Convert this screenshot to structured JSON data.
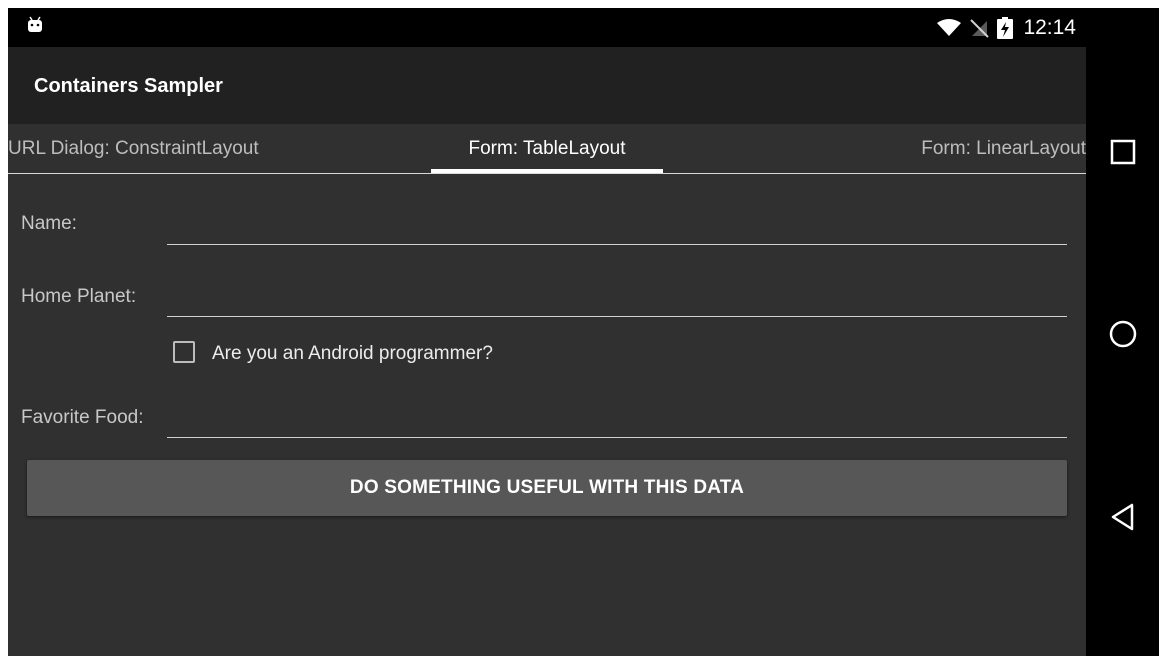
{
  "status_bar": {
    "time": "12:14",
    "icons": [
      "android-icon",
      "wifi-icon",
      "no-sim-icon",
      "battery-charging-icon"
    ]
  },
  "app_bar": {
    "title": "Containers Sampler"
  },
  "tabs": [
    {
      "label": "URL Dialog: ConstraintLayout",
      "selected": false
    },
    {
      "label": "Form: TableLayout",
      "selected": true
    },
    {
      "label": "Form: LinearLayout",
      "selected": false
    }
  ],
  "form": {
    "name_label": "Name:",
    "name_value": "",
    "home_planet_label": "Home Planet:",
    "home_planet_value": "",
    "android_programmer_label": "Are you an Android programmer?",
    "android_programmer_checked": false,
    "favorite_food_label": "Favorite Food:",
    "favorite_food_value": "",
    "submit_label": "DO SOMETHING USEFUL WITH THIS DATA"
  },
  "nav_bar": {
    "buttons": [
      "recents-icon",
      "home-icon",
      "back-icon"
    ]
  },
  "colors": {
    "screen_background": "#303030",
    "app_bar_background": "#212121",
    "button_background": "#575757",
    "tab_indicator": "#ffffff"
  }
}
